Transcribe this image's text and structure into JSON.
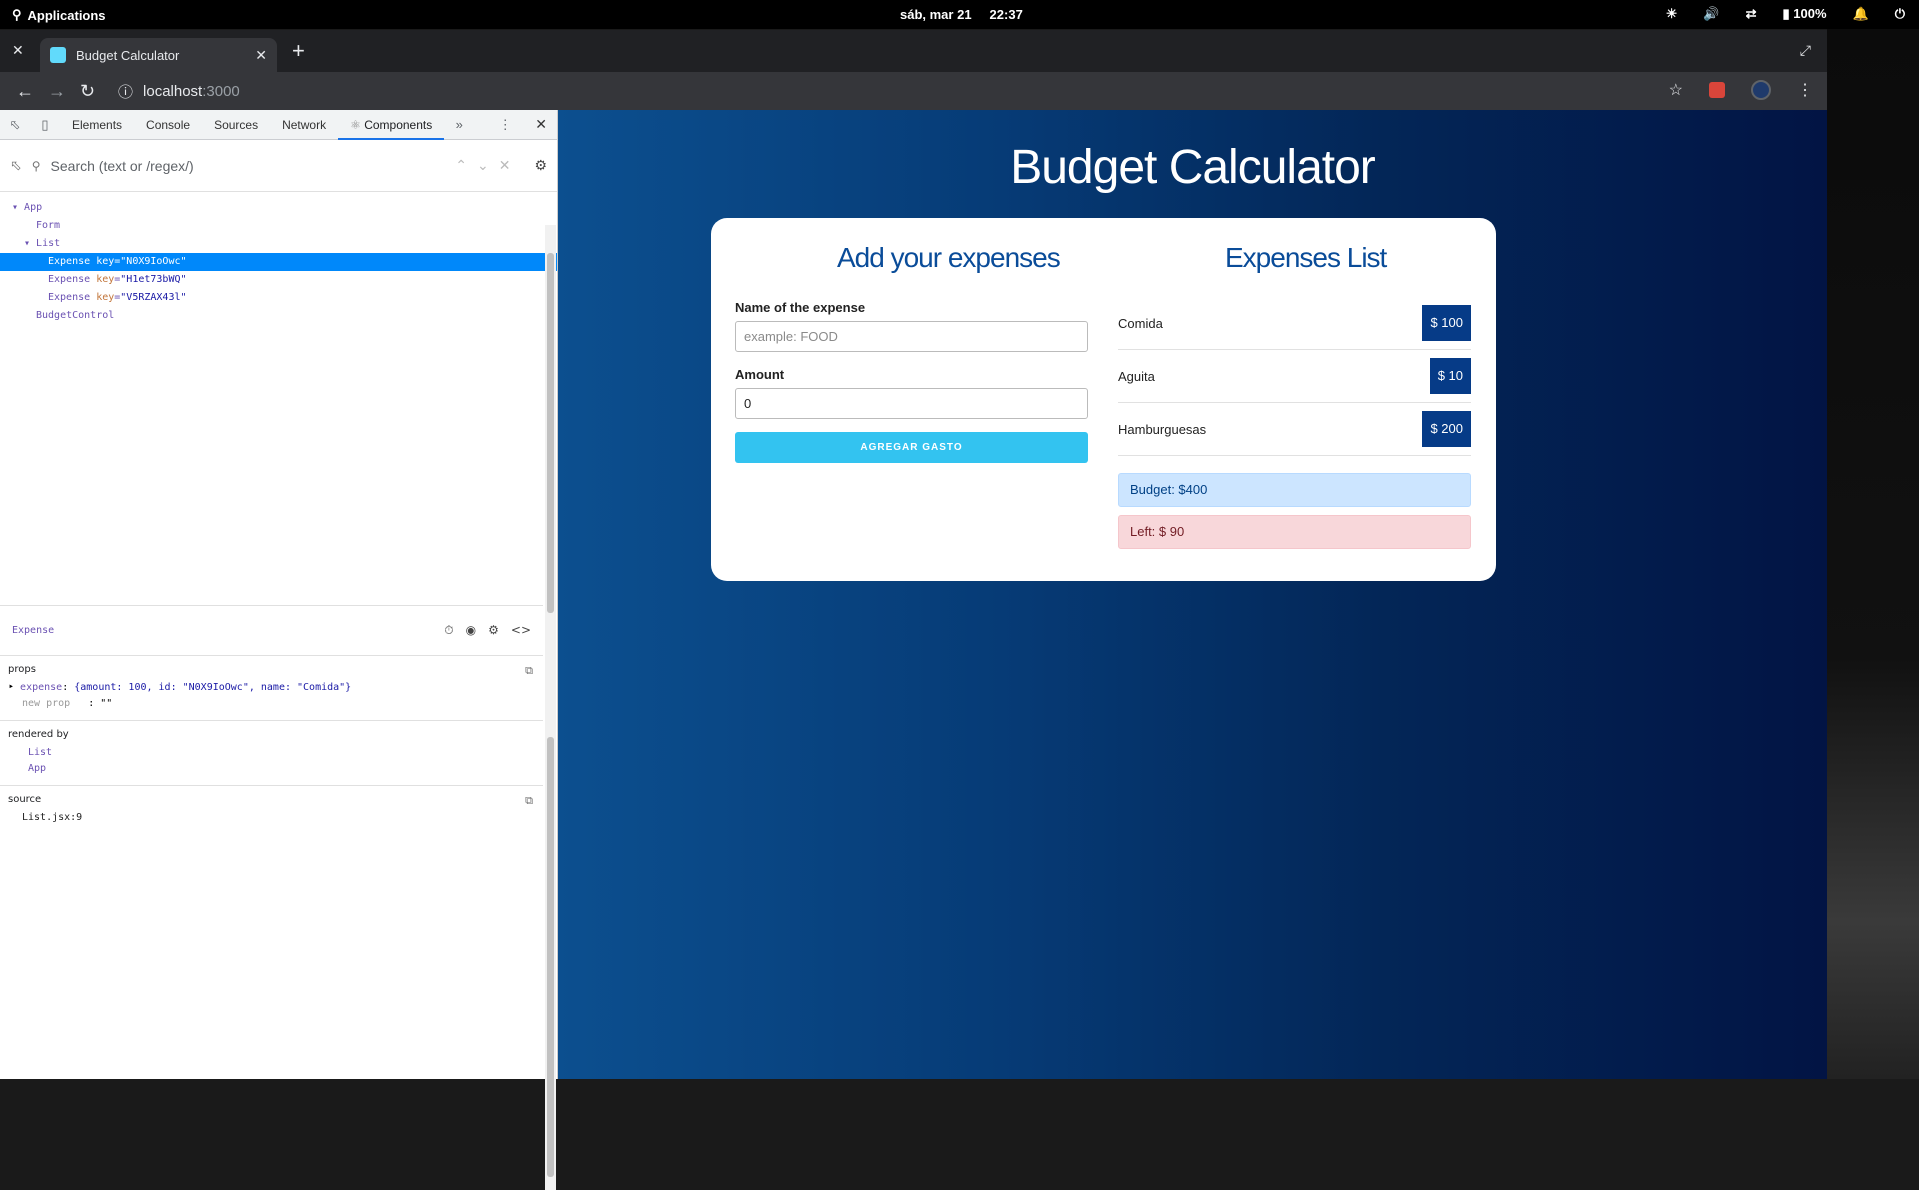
{
  "topbar": {
    "applications_label": "Applications",
    "date": "sáb, mar 21",
    "time": "22:37",
    "battery": "100%"
  },
  "browser": {
    "tab_title": "Budget Calculator",
    "url_host": "localhost",
    "url_port": ":3000"
  },
  "devtools": {
    "tabs": [
      "Elements",
      "Console",
      "Sources",
      "Network",
      "Components"
    ],
    "active_tab": "Components",
    "search_placeholder": "Search (text or /regex/)",
    "tree": {
      "app": "App",
      "form": "Form",
      "list": "List",
      "expenses": [
        {
          "name": "Expense",
          "key_label": "key",
          "key_value": "\"N0X9IoOwc\""
        },
        {
          "name": "Expense",
          "key_label": "key",
          "key_value": "\"H1et73bWQ\""
        },
        {
          "name": "Expense",
          "key_label": "key",
          "key_value": "\"V5RZAX43l\""
        }
      ],
      "budget_control": "BudgetControl"
    },
    "selected_component": "Expense",
    "props_title": "props",
    "prop_name": "expense",
    "prop_value": "{amount: 100, id: \"N0X9IoOwc\", name: \"Comida\"}",
    "new_prop_label": "new prop",
    "new_prop_value": ": \"\"",
    "rendered_by_title": "rendered by",
    "rendered_by": [
      "List",
      "App"
    ],
    "source_title": "source",
    "source_file": "List.jsx:9"
  },
  "app": {
    "title": "Budget Calculator",
    "form_title": "Add your expenses",
    "name_label": "Name of the expense",
    "name_placeholder": "example: FOOD",
    "amount_label": "Amount",
    "amount_value": "0",
    "submit_label": "AGREGAR GASTO",
    "list_title": "Expenses List",
    "expenses": [
      {
        "name": "Comida",
        "amount": "$ 100"
      },
      {
        "name": "Aguita",
        "amount": "$ 10"
      },
      {
        "name": "Hamburguesas",
        "amount": "$ 200"
      }
    ],
    "budget": "Budget: $400",
    "left": "Left: $ 90"
  }
}
